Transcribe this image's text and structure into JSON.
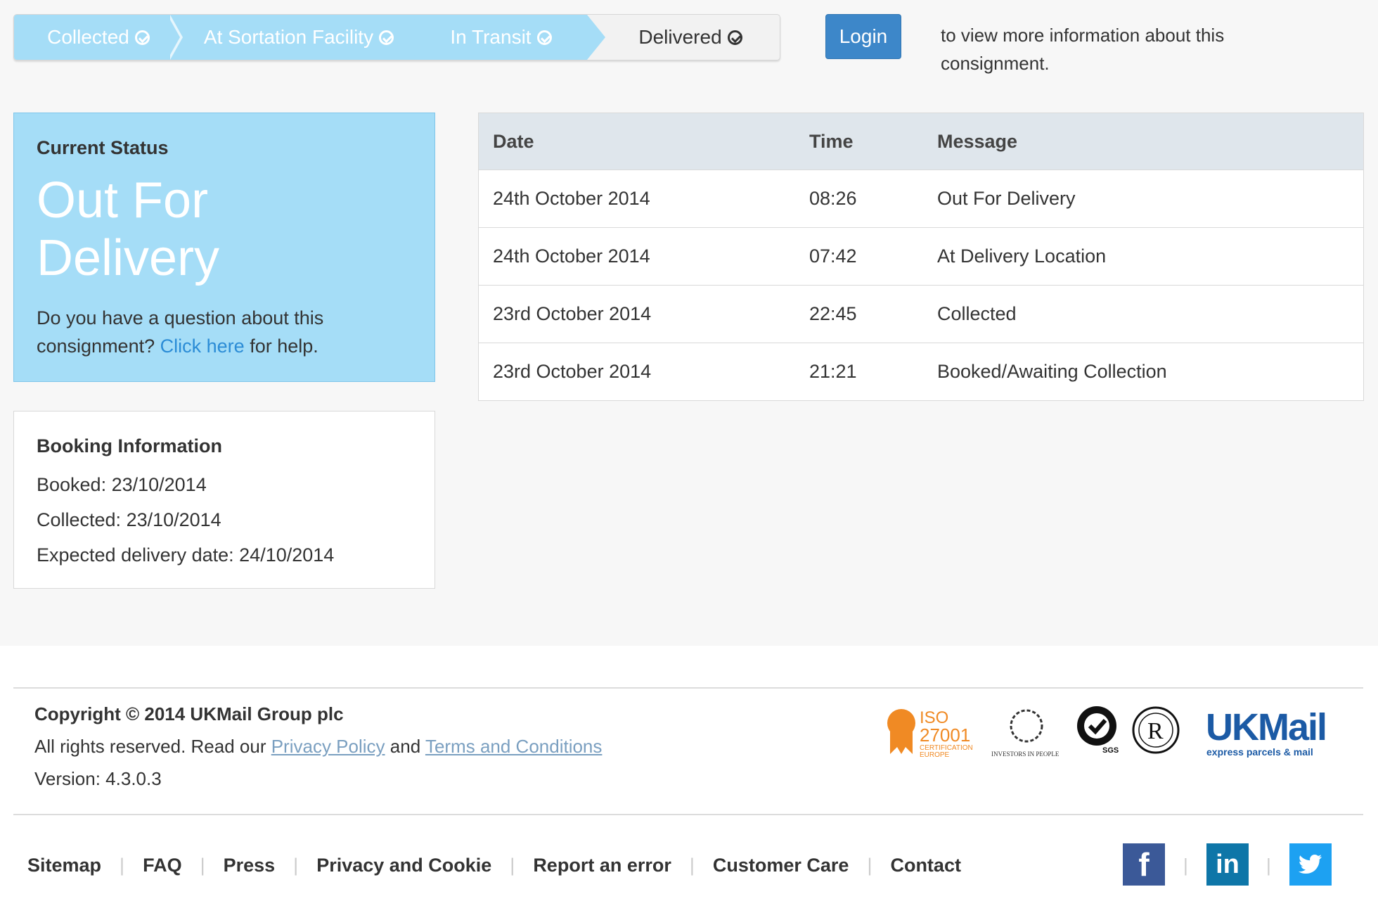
{
  "progress": {
    "steps": [
      {
        "label": "Collected",
        "state": "done"
      },
      {
        "label": "At Sortation Facility",
        "state": "done"
      },
      {
        "label": "In Transit",
        "state": "done"
      },
      {
        "label": "Delivered",
        "state": "pending"
      }
    ]
  },
  "login": {
    "button_label": "Login",
    "note": "to view more information about this consignment."
  },
  "status": {
    "label": "Current Status",
    "value": "Out For Delivery",
    "help_prefix": "Do you have a question about this consignment?",
    "help_link": "Click here",
    "help_suffix": "for help."
  },
  "booking": {
    "title": "Booking Information",
    "booked": "Booked: 23/10/2014",
    "collected": "Collected: 23/10/2014",
    "expected": "Expected delivery date: 24/10/2014"
  },
  "history": {
    "headers": [
      "Date",
      "Time",
      "Message"
    ],
    "rows": [
      {
        "date": "24th October 2014",
        "time": "08:26",
        "message": "Out For Delivery"
      },
      {
        "date": "24th October 2014",
        "time": "07:42",
        "message": "At Delivery Location"
      },
      {
        "date": "23rd October 2014",
        "time": "22:45",
        "message": "Collected"
      },
      {
        "date": "23rd October 2014",
        "time": "21:21",
        "message": "Booked/Awaiting Collection"
      }
    ]
  },
  "footer": {
    "copyright": "Copyright © 2014 UKMail Group plc",
    "rights_prefix": "All rights reserved. Read our",
    "privacy_link": "Privacy Policy",
    "and": "and",
    "terms_link": "Terms and Conditions",
    "version": "Version: 4.3.0.3",
    "nav": [
      "Sitemap",
      "FAQ",
      "Press",
      "Privacy and Cookie",
      "Report an error",
      "Customer Care",
      "Contact"
    ],
    "logos": {
      "iso_1": "ISO",
      "iso_2": "27001",
      "iso_3": "CERTIFICATION",
      "iso_4": "EUROPE",
      "iip": "INVESTORS IN PEOPLE",
      "sgs": "SGS",
      "r": "R",
      "ukmail": "UKMail",
      "ukmail_tag": "express parcels & mail"
    },
    "social": [
      {
        "icon": "facebook-icon",
        "glyph": "f",
        "color": "#3b5998"
      },
      {
        "icon": "linkedin-icon",
        "glyph": "in",
        "color": "#0e76a8"
      },
      {
        "icon": "twitter-icon",
        "glyph": "t",
        "color": "#1da1f2"
      }
    ]
  },
  "colors": {
    "step_done": "#a5ddf7",
    "login": "#3d87c9",
    "link": "#2b8cd6",
    "ukmail_blue": "#1b5aa5",
    "ukmail_red": "#d6232b",
    "iso_orange": "#f08a24"
  }
}
